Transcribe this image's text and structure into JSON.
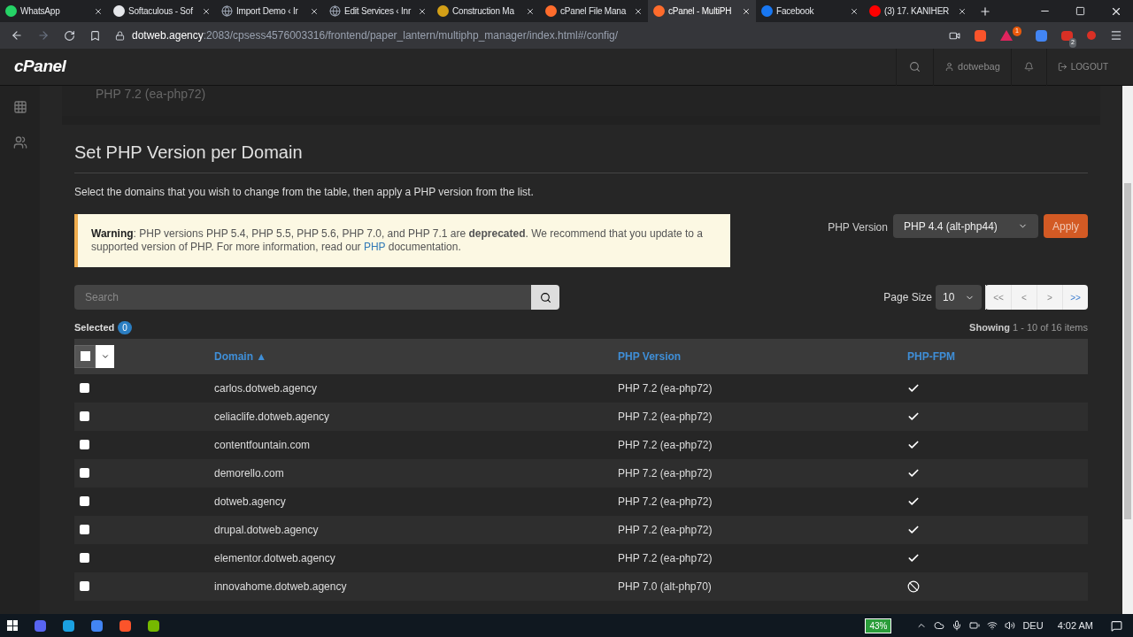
{
  "browser": {
    "tabs": [
      {
        "title": "WhatsApp",
        "kind": "whatsapp",
        "selected": false
      },
      {
        "title": "Softaculous - Sof",
        "kind": "softaculous",
        "selected": false
      },
      {
        "title": "Import Demo ‹ Ir",
        "kind": "globe",
        "selected": false
      },
      {
        "title": "Edit Services ‹ Inr",
        "kind": "globe",
        "selected": false
      },
      {
        "title": "Construction Ma",
        "kind": "construction",
        "selected": false
      },
      {
        "title": "cPanel File Mana",
        "kind": "cpanel",
        "selected": false
      },
      {
        "title": "cPanel - MultiPH",
        "kind": "cpanel",
        "selected": true
      },
      {
        "title": "Facebook",
        "kind": "facebook",
        "selected": false
      },
      {
        "title": "(3) 17. KANIHER",
        "kind": "youtube",
        "selected": false
      }
    ],
    "url": {
      "host": "dotweb.agency",
      "rest": ":2083/cpsess4576003316/frontend/paper_lantern/multiphp_manager/index.html#/config/"
    },
    "extension_badges": [
      "1",
      "2"
    ]
  },
  "header": {
    "logo": "cPanel",
    "user": "dotwebag",
    "logout": "LOGOUT"
  },
  "previous_section_text": "PHP 7.2 (ea-php72)",
  "section": {
    "title": "Set PHP Version per Domain",
    "intro": "Select the domains that you wish to change from the table, then apply a PHP version from the list.",
    "warning": {
      "label": "Warning",
      "before": ": PHP versions PHP 5.4, PHP 5.5, PHP 5.6, PHP 7.0, and PHP 7.1 are **deprecated**. We recommend that you update to a supported version of PHP. For more information, read our ",
      "link": "PHP",
      "after": " documentation."
    },
    "php_version": {
      "label": "PHP Version",
      "value": "PHP 4.4 (alt-php44)",
      "apply": "Apply"
    },
    "search": {
      "placeholder": "Search"
    },
    "page_size": {
      "label": "Page Size",
      "value": "10"
    },
    "pager": [
      {
        "label": "<<",
        "disabled": true
      },
      {
        "label": "<",
        "disabled": true
      },
      {
        "label": ">",
        "disabled": true
      },
      {
        "label": ">>",
        "disabled": false
      }
    ],
    "selected": {
      "label": "Selected",
      "count": "0"
    },
    "select_all": {
      "checked": false
    },
    "showing": {
      "label": "Showing",
      "range": "1 - 10 of 16 items"
    },
    "table": {
      "columns": [
        "Domain ▲",
        "PHP Version",
        "PHP-FPM"
      ],
      "rows": [
        {
          "domain": "carlos.dotweb.agency",
          "version": "PHP 7.2 (ea-php72)",
          "fpm": true,
          "checked": false
        },
        {
          "domain": "celiaclife.dotweb.agency",
          "version": "PHP 7.2 (ea-php72)",
          "fpm": true,
          "checked": false
        },
        {
          "domain": "contentfountain.com",
          "version": "PHP 7.2 (ea-php72)",
          "fpm": true,
          "checked": false
        },
        {
          "domain": "demorello.com",
          "version": "PHP 7.2 (ea-php72)",
          "fpm": true,
          "checked": false
        },
        {
          "domain": "dotweb.agency",
          "version": "PHP 7.2 (ea-php72)",
          "fpm": true,
          "checked": false
        },
        {
          "domain": "drupal.dotweb.agency",
          "version": "PHP 7.2 (ea-php72)",
          "fpm": true,
          "checked": false
        },
        {
          "domain": "elementor.dotweb.agency",
          "version": "PHP 7.2 (ea-php72)",
          "fpm": true,
          "checked": false
        },
        {
          "domain": "innovahome.dotweb.agency",
          "version": "PHP 7.0 (alt-php70)",
          "fpm": false,
          "checked": false
        }
      ]
    }
  },
  "taskbar": {
    "battery": "43%",
    "language": "DEU",
    "time": "4:02 AM"
  }
}
